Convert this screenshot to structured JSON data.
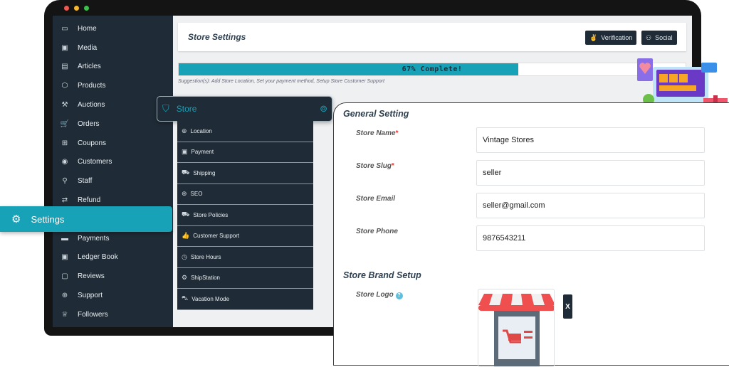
{
  "window": {
    "dots": [
      "#ee5a52",
      "#f5b82e",
      "#3dc14c"
    ]
  },
  "sidebar": {
    "items": [
      {
        "label": "Home",
        "icon": "monitor-icon",
        "glyph": "▭"
      },
      {
        "label": "Media",
        "icon": "image-icon",
        "glyph": "▣"
      },
      {
        "label": "Articles",
        "icon": "document-icon",
        "glyph": "▤"
      },
      {
        "label": "Products",
        "icon": "box-icon",
        "glyph": "⬡"
      },
      {
        "label": "Auctions",
        "icon": "gavel-icon",
        "glyph": "⚒"
      },
      {
        "label": "Orders",
        "icon": "cart-icon",
        "glyph": "🛒"
      },
      {
        "label": "Coupons",
        "icon": "gift-icon",
        "glyph": "⊞"
      },
      {
        "label": "Customers",
        "icon": "user-circle-icon",
        "glyph": "◉"
      },
      {
        "label": "Staff",
        "icon": "user-icon",
        "glyph": "⚲"
      },
      {
        "label": "Refund",
        "icon": "refund-icon",
        "glyph": "⇄"
      },
      {
        "label": "Settings",
        "icon": "gears-icon",
        "glyph": "⚙"
      },
      {
        "label": "Payments",
        "icon": "credit-card-icon",
        "glyph": "▬"
      },
      {
        "label": "Ledger Book",
        "icon": "money-icon",
        "glyph": "▣"
      },
      {
        "label": "Reviews",
        "icon": "comment-icon",
        "glyph": "▢"
      },
      {
        "label": "Support",
        "icon": "globe-icon",
        "glyph": "⊕"
      },
      {
        "label": "Followers",
        "icon": "trophy-icon",
        "glyph": "♕"
      }
    ]
  },
  "header": {
    "title": "Store Settings",
    "verification_label": "Verification",
    "social_label": "Social"
  },
  "progress": {
    "percent": 67,
    "label": "67% Complete!",
    "suggestion": "Suggestion(s): Add Store Location, Set your payment method, Setup Store Customer Support"
  },
  "settings_highlight": {
    "label": "Settings"
  },
  "store_menu": {
    "label": "Store",
    "items": [
      {
        "label": "Location",
        "icon": "globe-icon",
        "glyph": "⊕"
      },
      {
        "label": "Payment",
        "icon": "money-icon",
        "glyph": "▣"
      },
      {
        "label": "Shipping",
        "icon": "truck-icon",
        "glyph": "⛟"
      },
      {
        "label": "SEO",
        "icon": "globe-icon",
        "glyph": "⊕"
      },
      {
        "label": "Store Policies",
        "icon": "truck-icon",
        "glyph": "⛟"
      },
      {
        "label": "Customer Support",
        "icon": "thumbs-up-icon",
        "glyph": "👍"
      },
      {
        "label": "Store Hours",
        "icon": "clock-icon",
        "glyph": "◷"
      },
      {
        "label": "ShipStation",
        "icon": "gear-icon",
        "glyph": "⚙"
      },
      {
        "label": "Vacation Mode",
        "icon": "vacation-icon",
        "glyph": "⛍"
      }
    ]
  },
  "general": {
    "title": "General Setting",
    "fields": [
      {
        "label": "Store Name",
        "required": "*",
        "value": "Vintage Stores"
      },
      {
        "label": "Store Slug",
        "required": "*",
        "value": "seller"
      },
      {
        "label": "Store Email",
        "required": "",
        "value": "seller@gmail.com"
      },
      {
        "label": "Store Phone",
        "required": "",
        "value": "9876543211"
      }
    ]
  },
  "brand": {
    "title": "Store Brand Setup",
    "logo_label": "Store Logo",
    "remove_label": "X"
  },
  "colors": {
    "accent": "#17a2b8",
    "sidebar": "#1f2b36"
  }
}
